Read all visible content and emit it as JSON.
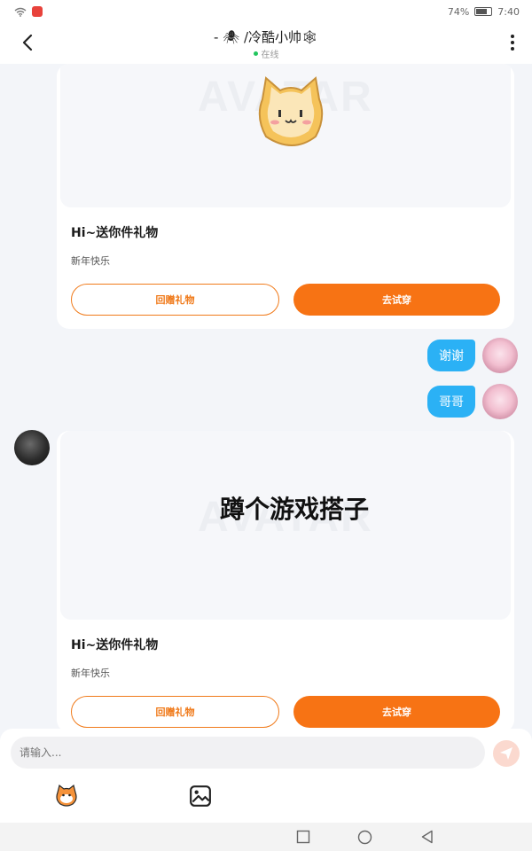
{
  "status_bar": {
    "battery": "74%",
    "battery_level": 0.74,
    "time": "7:40"
  },
  "header": {
    "title": "- 🕷 /冷酷小帅🕸",
    "status": "在线"
  },
  "gift_cards": [
    {
      "image_text": "",
      "title": "Hi~送你件礼物",
      "subtitle": "新年快乐",
      "return_label": "回赠礼物",
      "try_label": "去试穿"
    },
    {
      "image_text": "蹲个游戏搭子",
      "title": "Hi~送你件礼物",
      "subtitle": "新年快乐",
      "return_label": "回赠礼物",
      "try_label": "去试穿"
    }
  ],
  "messages": [
    {
      "text": "谢谢",
      "from": "me"
    },
    {
      "text": "哥哥",
      "from": "me"
    }
  ],
  "input": {
    "placeholder": "请输入..."
  },
  "toolbar": {
    "emoji_icon": "cat-sticker-icon",
    "image_icon": "image-icon"
  },
  "colors": {
    "accent": "#f77314",
    "bubble": "#2bb1f5",
    "online": "#22c55e",
    "background": "#f3f5f9"
  }
}
